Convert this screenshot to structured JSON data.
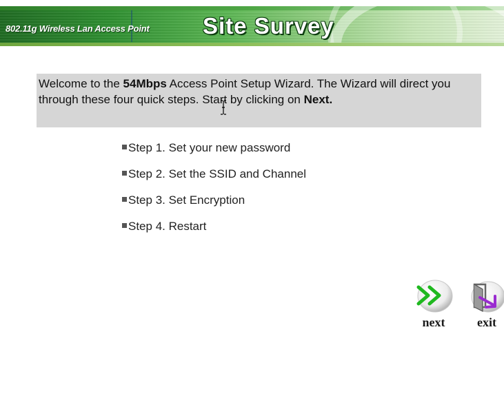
{
  "header": {
    "subtitle": "802.11g Wireless Lan Access Point",
    "title": "Site Survey"
  },
  "welcome": {
    "part1": "Welcome to the ",
    "bold1": "54Mbps",
    "part2": " Access Point Setup Wizard. The Wizard will direct you through these four quick steps. Start by clicking on ",
    "bold2": "Next."
  },
  "steps": [
    {
      "label": "Step 1. Set your new password"
    },
    {
      "label": "Step 2. Set the SSID and Channel"
    },
    {
      "label": "Step 3. Set Encryption"
    },
    {
      "label": "Step 4. Restart"
    }
  ],
  "nav": {
    "next_label": "next",
    "exit_label": "exit"
  },
  "icons": {
    "next": "double-chevron-right-icon",
    "exit": "exit-arrow-icon"
  },
  "colors": {
    "banner_green": "#2f8f31",
    "next_arrow": "#1fb81f",
    "exit_arrow": "#9a2bd0",
    "welcome_bg": "#d6d6d6"
  }
}
